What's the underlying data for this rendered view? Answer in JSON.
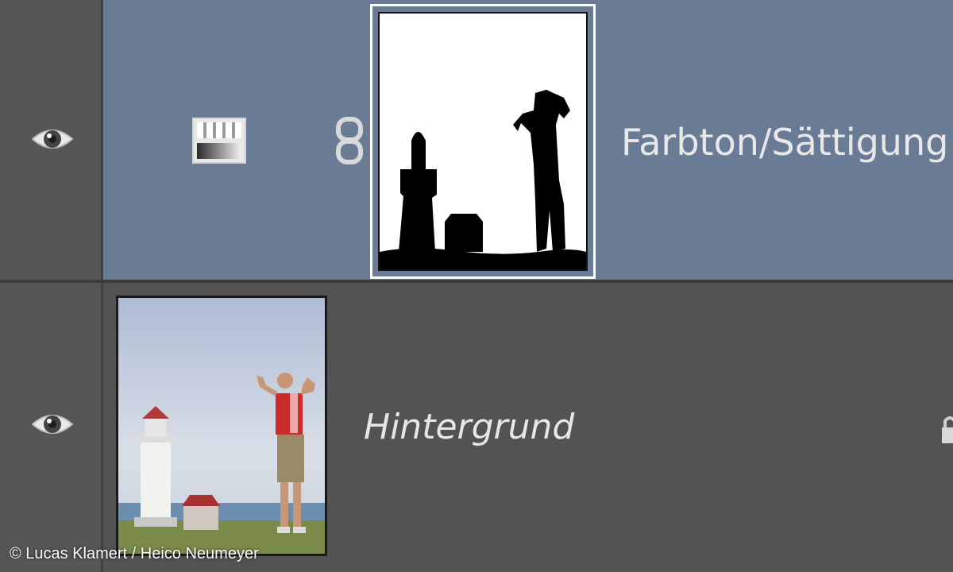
{
  "layers": [
    {
      "name": "Farbton/Sättigung",
      "type": "adjustment",
      "selected": true,
      "visible": true,
      "icons": [
        "eye-icon",
        "adjustment-icon",
        "link-icon",
        "layer-mask-thumbnail"
      ]
    },
    {
      "name": "Hintergrund",
      "type": "background",
      "selected": false,
      "visible": true,
      "locked": true,
      "icons": [
        "eye-icon",
        "layer-thumbnail",
        "lock-icon"
      ]
    }
  ],
  "copyright": "© Lucas Klamert / Heico Neumeyer",
  "colors": {
    "panel_bg": "#535353",
    "selected_bg": "#6a7b96",
    "divider": "#3d3d3d",
    "text": "#e8e8e8"
  }
}
